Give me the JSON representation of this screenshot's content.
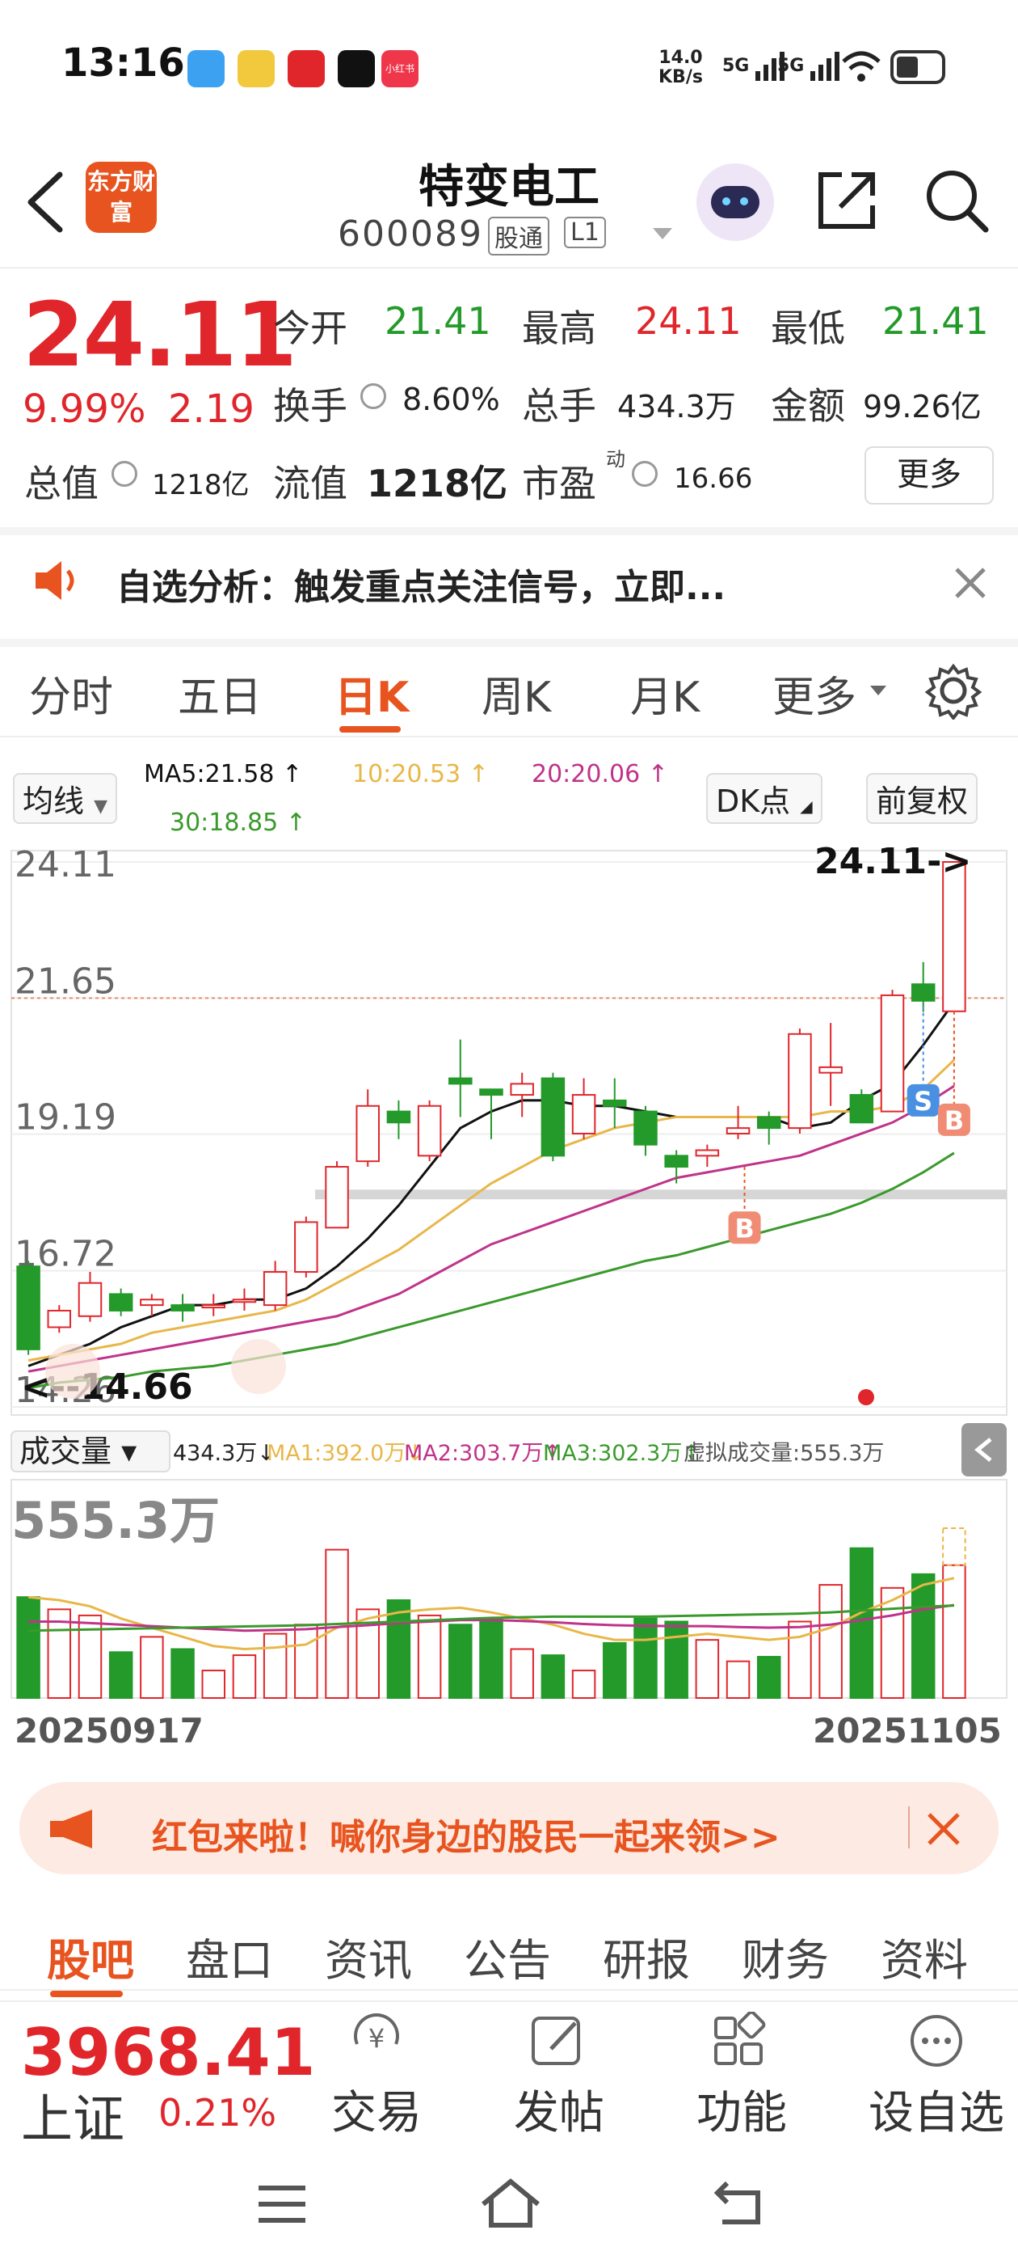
{
  "status_bar": {
    "time": "13:16",
    "net_speed_value": "14.0",
    "net_speed_unit": "KB/s",
    "signal1": "5G",
    "signal2": "5G",
    "app_icons": [
      {
        "name": "message-app-icon",
        "color": "#3da1f2"
      },
      {
        "name": "sim-app-icon",
        "color": "#f2c83d"
      },
      {
        "name": "pinduoduo-app-icon",
        "color": "#e0262b"
      },
      {
        "name": "tiktok-app-icon",
        "color": "#111111"
      },
      {
        "name": "xiaohongshu-app-icon",
        "color": "#f0364b",
        "label": "小红书"
      }
    ]
  },
  "header": {
    "brand": "东方财富",
    "stock_name": "特变电工",
    "stock_code": "600089",
    "tag_hkconnect": "股通",
    "tag_level": "L1"
  },
  "quote": {
    "price": "24.11",
    "change_pct": "9.99%",
    "change_amt": "2.19",
    "rows": [
      [
        {
          "label": "今开",
          "value": "21.41",
          "color": "green"
        },
        {
          "label": "最高",
          "value": "24.11",
          "color": "red"
        },
        {
          "label": "最低",
          "value": "21.41",
          "color": "green"
        }
      ],
      [
        {
          "label": "换手",
          "value": "8.60%",
          "color": "black"
        },
        {
          "label": "总手",
          "value": "434.3万",
          "color": "black"
        },
        {
          "label": "金额",
          "value": "99.26亿",
          "color": "black"
        }
      ]
    ],
    "total_value_label": "总值",
    "total_value": "1218亿",
    "float_value_label": "流值",
    "float_value": "1218亿",
    "pe_label": "市盈",
    "pe_sup": "动",
    "pe_value": "16.66",
    "more_label": "更多"
  },
  "notice": {
    "text": "自选分析：触发重点关注信号，立即..."
  },
  "chart_tabs": {
    "items": [
      "分时",
      "五日",
      "日K",
      "周K",
      "月K",
      "更多"
    ],
    "active": "日K"
  },
  "ma_bar": {
    "selector": "均线",
    "ma5": "MA5:21.58 ↑",
    "ma10": "10:20.53 ↑",
    "ma20": "20:20.06 ↑",
    "ma30": "30:18.85 ↑",
    "dk_label": "DK点",
    "adjust_label": "前复权",
    "colors": {
      "ma5": "#111111",
      "ma10": "#e8b74a",
      "ma20": "#c0338a",
      "ma30": "#3a9a2c"
    }
  },
  "volume_bar": {
    "selector": "成交量",
    "vol": "434.3万↓",
    "ma1": "MA1:392.0万↓",
    "ma2": "MA2:303.7万↑",
    "ma3": "MA3:302.3万↑",
    "virtual": "虚拟成交量:555.3万"
  },
  "chart_data": {
    "type": "candlestick",
    "y_ticks": [
      "24.11",
      "21.65",
      "19.19",
      "16.72",
      "14.26"
    ],
    "ylim": [
      14.26,
      24.11
    ],
    "last_price_label": "24.11->",
    "low_label": "<--14.66",
    "volume_max_label": "555.3万",
    "start_date": "20250917",
    "end_date": "20251105",
    "candles": [
      [
        16.8,
        15.3,
        16.9,
        15.2
      ],
      [
        15.7,
        16.0,
        16.1,
        15.6
      ],
      [
        15.9,
        16.5,
        16.7,
        15.8
      ],
      [
        16.3,
        16.0,
        16.4,
        15.9
      ],
      [
        16.1,
        16.2,
        16.3,
        15.9
      ],
      [
        16.1,
        16.0,
        16.3,
        15.8
      ],
      [
        16.1,
        16.1,
        16.3,
        15.9
      ],
      [
        16.2,
        16.2,
        16.4,
        16.0
      ],
      [
        16.1,
        16.7,
        16.9,
        16.0
      ],
      [
        16.7,
        17.6,
        17.7,
        16.6
      ],
      [
        17.5,
        18.6,
        18.7,
        17.5
      ],
      [
        18.7,
        19.7,
        20.0,
        18.6
      ],
      [
        19.6,
        19.4,
        19.8,
        19.1
      ],
      [
        18.8,
        19.7,
        19.8,
        18.7
      ],
      [
        20.2,
        20.1,
        20.9,
        19.5
      ],
      [
        20.0,
        19.9,
        20.0,
        19.1
      ],
      [
        19.9,
        20.1,
        20.3,
        19.5
      ],
      [
        20.2,
        18.8,
        20.3,
        18.7
      ],
      [
        19.2,
        19.9,
        20.2,
        19.1
      ],
      [
        19.8,
        19.7,
        20.2,
        19.3
      ],
      [
        19.6,
        19.0,
        19.7,
        18.8
      ],
      [
        18.8,
        18.6,
        18.9,
        18.3
      ],
      [
        18.8,
        18.9,
        19.0,
        18.6
      ],
      [
        19.2,
        19.3,
        19.7,
        19.1
      ],
      [
        19.5,
        19.3,
        19.6,
        19.0
      ],
      [
        19.3,
        21.0,
        21.1,
        19.2
      ],
      [
        20.3,
        20.4,
        21.2,
        19.7
      ],
      [
        19.9,
        19.4,
        20.0,
        19.4
      ],
      [
        19.6,
        21.7,
        21.8,
        19.6
      ],
      [
        21.9,
        21.6,
        22.3,
        21.4
      ],
      [
        21.41,
        24.11,
        24.11,
        21.41
      ]
    ],
    "ma_series": [
      {
        "name": "MA5",
        "values": [
          15.0,
          15.2,
          15.4,
          15.7,
          15.9,
          16.1,
          16.1,
          16.2,
          16.2,
          16.4,
          16.8,
          17.3,
          17.9,
          18.6,
          19.3,
          19.6,
          19.8,
          19.8,
          19.7,
          19.7,
          19.6,
          19.5,
          19.5,
          19.5,
          19.5,
          19.3,
          19.4,
          19.8,
          20.1,
          20.8,
          21.58
        ]
      },
      {
        "name": "10",
        "values": [
          15.1,
          15.2,
          15.3,
          15.4,
          15.6,
          15.7,
          15.8,
          15.9,
          16.0,
          16.2,
          16.5,
          16.8,
          17.1,
          17.5,
          17.9,
          18.3,
          18.6,
          18.9,
          19.1,
          19.3,
          19.4,
          19.5,
          19.5,
          19.5,
          19.5,
          19.5,
          19.6,
          19.6,
          19.7,
          20.0,
          20.53
        ]
      },
      {
        "name": "20",
        "values": [
          14.9,
          15.0,
          15.1,
          15.2,
          15.3,
          15.4,
          15.5,
          15.6,
          15.7,
          15.8,
          15.9,
          16.1,
          16.3,
          16.6,
          16.9,
          17.2,
          17.4,
          17.6,
          17.8,
          18.0,
          18.2,
          18.4,
          18.5,
          18.6,
          18.7,
          18.8,
          19.0,
          19.2,
          19.4,
          19.7,
          20.06
        ]
      },
      {
        "name": "30",
        "values": [
          14.6,
          14.7,
          14.75,
          14.8,
          14.9,
          14.95,
          15.0,
          15.1,
          15.2,
          15.3,
          15.4,
          15.55,
          15.7,
          15.85,
          16.0,
          16.15,
          16.3,
          16.45,
          16.6,
          16.75,
          16.9,
          17.0,
          17.15,
          17.3,
          17.45,
          17.6,
          17.75,
          17.95,
          18.2,
          18.5,
          18.85
        ]
      }
    ],
    "volumes": [
      330,
      290,
      270,
      150,
      200,
      160,
      90,
      140,
      210,
      240,
      485,
      290,
      320,
      270,
      240,
      260,
      160,
      140,
      90,
      180,
      260,
      250,
      190,
      120,
      135,
      250,
      370,
      490,
      360,
      405,
      434.3
    ]
  },
  "promo": {
    "text": "红包来啦！喊你身边的股民一起来领>>"
  },
  "sub_tabs": {
    "items": [
      "股吧",
      "盘口",
      "资讯",
      "公告",
      "研报",
      "财务",
      "资料"
    ],
    "active": "股吧"
  },
  "bottom_bar": {
    "index_value": "3968.41",
    "index_name": "上证",
    "index_change": "0.21%",
    "items": [
      {
        "name": "trade",
        "icon": "yen-icon",
        "label": "交易"
      },
      {
        "name": "post",
        "icon": "edit-icon",
        "label": "发帖"
      },
      {
        "name": "function",
        "icon": "grid-icon",
        "label": "功能"
      },
      {
        "name": "add-watchlist",
        "icon": "more-dots-icon",
        "label": "设自选"
      }
    ]
  },
  "colors": {
    "up": "#e0262b",
    "down": "#239a2a",
    "accent": "#e8541f"
  }
}
